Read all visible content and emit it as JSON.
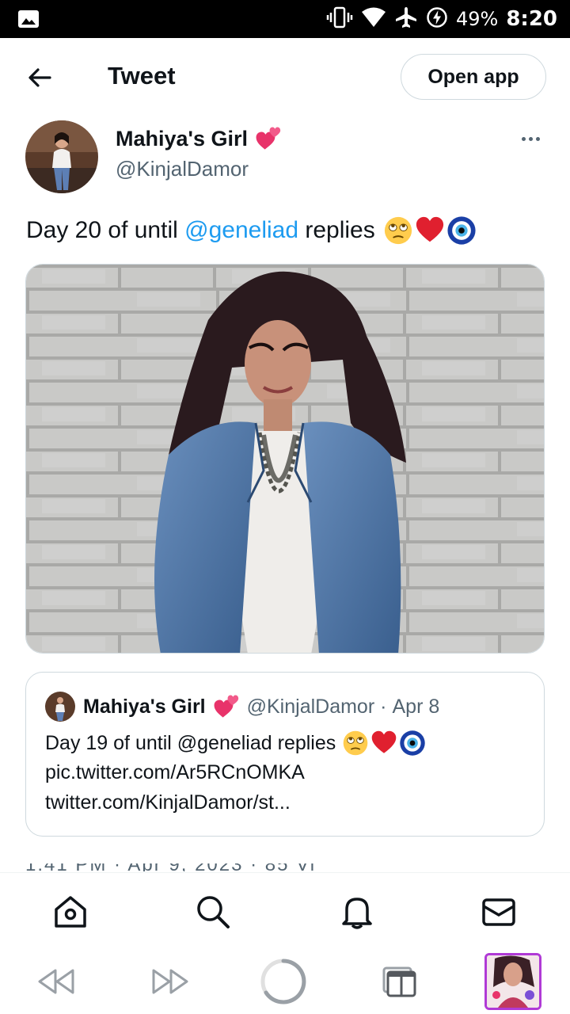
{
  "status_bar": {
    "battery": "49%",
    "time": "8:20",
    "icons": [
      "image-icon",
      "vibrate-icon",
      "wifi-icon",
      "airplane-icon",
      "battery-charging-icon"
    ]
  },
  "header": {
    "title": "Tweet",
    "open_app_label": "Open app",
    "icons": [
      "back-arrow-icon"
    ]
  },
  "tweet": {
    "author_name": "Mahiya's Girl",
    "author_handle": "@KinjalDamor",
    "text_before": "Day 20 of until ",
    "mention": "@geneliad",
    "text_after": " replies",
    "emojis": [
      "rolling-eyes-emoji",
      "red-heart-emoji",
      "nazar-amulet-emoji"
    ]
  },
  "quoted_tweet": {
    "author_name": "Mahiya's Girl",
    "author_handle": "@KinjalDamor",
    "dot": "·",
    "date": "Apr 8",
    "text": "Day 19 of until @geneliad replies",
    "link1": "pic.twitter.com/Ar5RCnOMKA",
    "link2": "twitter.com/KinjalDamor/st..."
  },
  "meta_clipped": "1:41 PM · Apr 9, 2023 · 85 Vi",
  "bottom_nav": {
    "icons": [
      "home-icon",
      "search-icon",
      "notifications-bell-icon",
      "messages-envelope-icon"
    ]
  },
  "browser_bar": {
    "icons": [
      "rewind-icon",
      "fast-forward-icon",
      "loading-circle-icon",
      "tabs-icon"
    ]
  },
  "colors": {
    "accent": "#1d9bf0",
    "text": "#0f1419",
    "secondary": "#536471",
    "border": "#cfd9de"
  }
}
